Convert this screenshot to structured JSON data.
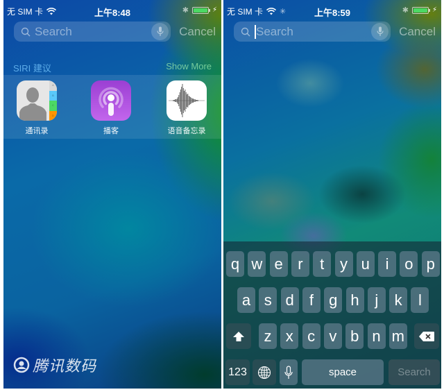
{
  "left_screen": {
    "status_bar": {
      "carrier": "无 SIM 卡",
      "time": "上午8:48",
      "battery_level": 1.0
    },
    "search": {
      "placeholder": "Search",
      "cancel_label": "Cancel"
    },
    "siri_suggestions": {
      "title": "SIRI 建议",
      "show_more_label": "Show More",
      "apps": [
        {
          "name": "通讯录",
          "icon": "contacts-icon"
        },
        {
          "name": "播客",
          "icon": "podcasts-icon"
        },
        {
          "name": "语音备忘录",
          "icon": "voice-memos-icon"
        }
      ],
      "contacts_tabs": [
        "A",
        "B",
        "C",
        "D"
      ]
    },
    "watermark": "腾讯数码"
  },
  "right_screen": {
    "status_bar": {
      "carrier": "无 SIM 卡",
      "time": "上午8:59",
      "battery_level": 1.0
    },
    "search": {
      "placeholder": "Search",
      "cancel_label": "Cancel"
    },
    "keyboard": {
      "row1": [
        "q",
        "w",
        "e",
        "r",
        "t",
        "y",
        "u",
        "i",
        "o",
        "p"
      ],
      "row2": [
        "a",
        "s",
        "d",
        "f",
        "g",
        "h",
        "j",
        "k",
        "l"
      ],
      "row3": [
        "z",
        "x",
        "c",
        "v",
        "b",
        "n",
        "m"
      ],
      "numbers_label": "123",
      "space_label": "space",
      "search_label": "Search"
    }
  },
  "colors": {
    "battery": "#4cd964",
    "siri_title": "#78c8ff",
    "show_more": "#96e6aa",
    "podcasts_top": "#9b3fd3",
    "podcasts_bottom": "#c266ec"
  }
}
